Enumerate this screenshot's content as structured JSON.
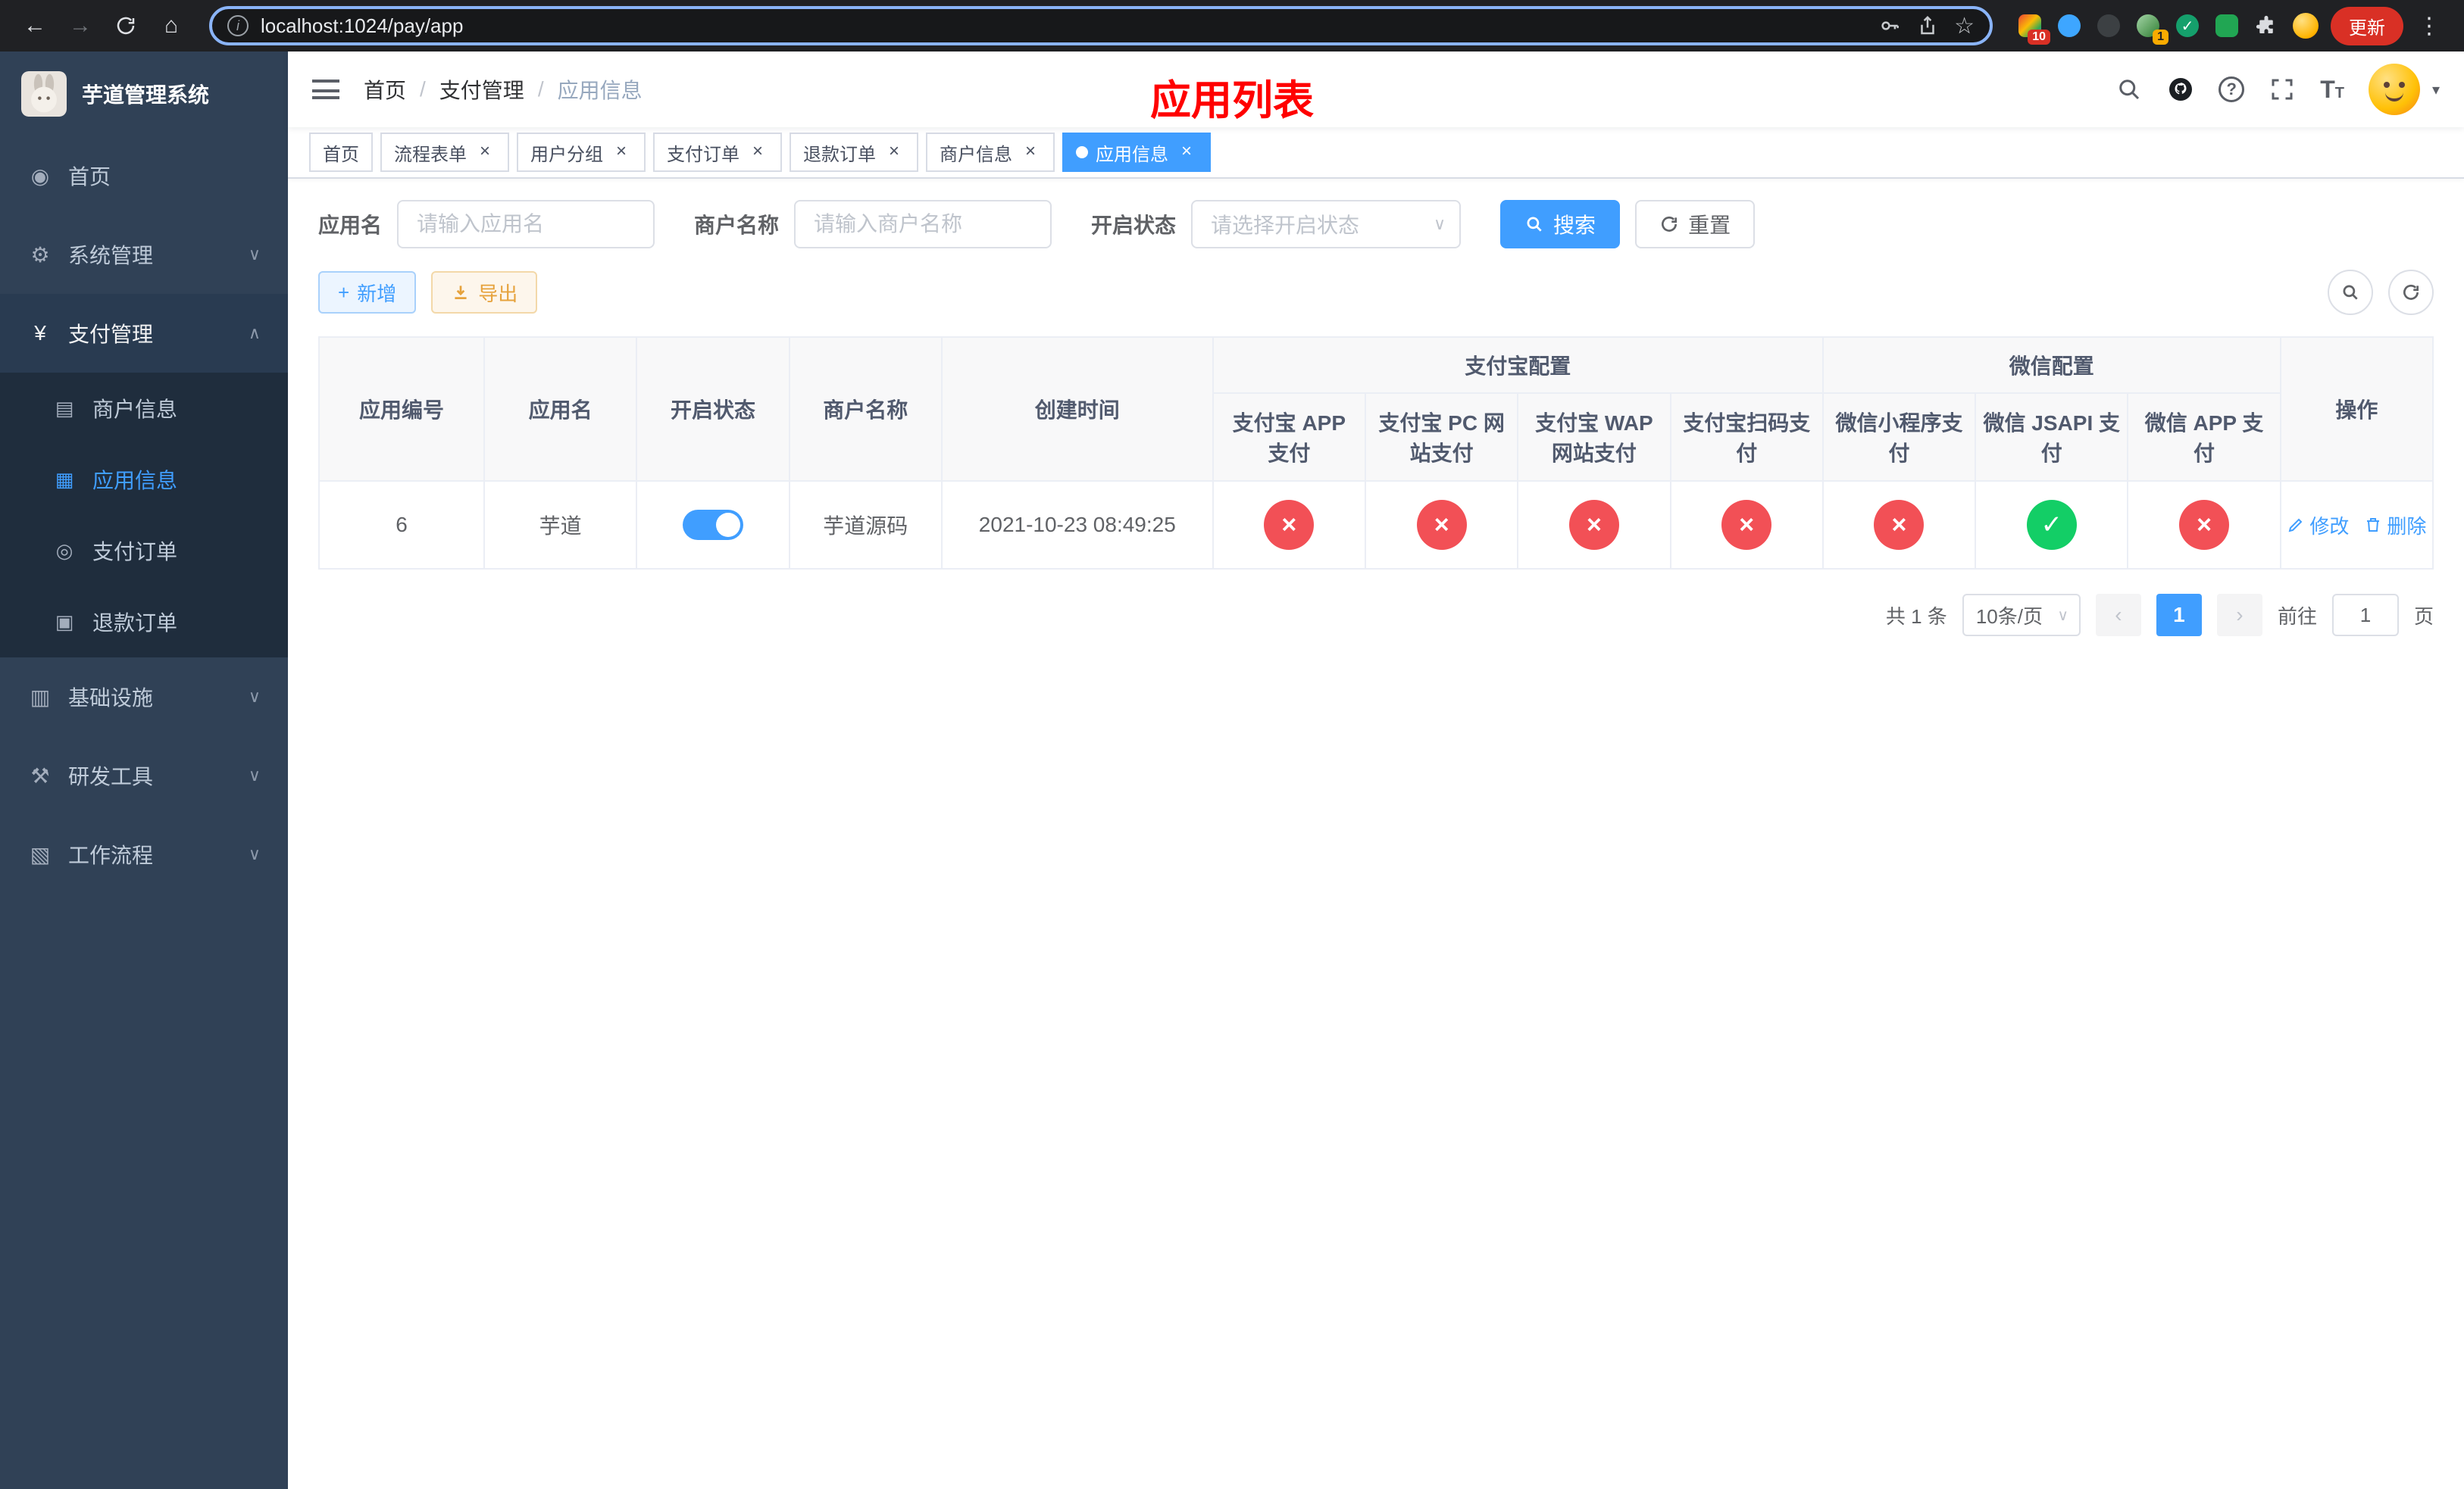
{
  "icons": {
    "back": "←",
    "forward": "→",
    "home": "⌂",
    "star": "☆",
    "more": "⋮",
    "info": "i",
    "close": "×",
    "separator": "/",
    "chevron_down": "∨",
    "chevron_up": "∧",
    "caret_down": "▾",
    "plus": "+",
    "check": "✓",
    "cross": "×",
    "prev": "‹",
    "next": "›",
    "question": "?",
    "menu_home": "◉",
    "menu_system": "⚙",
    "menu_pay": "¥",
    "menu_merchant": "▤",
    "menu_app": "▦",
    "menu_order": "◎",
    "menu_refund": "▣",
    "menu_infra": "▥",
    "menu_dev": "⚒",
    "menu_flow": "▧",
    "font_large": "T",
    "font_small": "T"
  },
  "browser": {
    "url": "localhost:1024/pay/app",
    "update_label": "更新",
    "ext_badge_1": "10",
    "ext_badge_2": "1"
  },
  "sidebar": {
    "title": "芋道管理系统",
    "menu": [
      {
        "label": "首页"
      },
      {
        "label": "系统管理"
      },
      {
        "label": "支付管理"
      },
      {
        "label": "商户信息"
      },
      {
        "label": "应用信息"
      },
      {
        "label": "支付订单"
      },
      {
        "label": "退款订单"
      },
      {
        "label": "基础设施"
      },
      {
        "label": "研发工具"
      },
      {
        "label": "工作流程"
      }
    ]
  },
  "header": {
    "breadcrumb": [
      "首页",
      "支付管理",
      "应用信息"
    ],
    "page_title": "应用列表"
  },
  "tabs": [
    {
      "label": "首页"
    },
    {
      "label": "流程表单"
    },
    {
      "label": "用户分组"
    },
    {
      "label": "支付订单"
    },
    {
      "label": "退款订单"
    },
    {
      "label": "商户信息"
    },
    {
      "label": "应用信息"
    }
  ],
  "filters": {
    "app_name_label": "应用名",
    "app_name_placeholder": "请输入应用名",
    "merchant_label": "商户名称",
    "merchant_placeholder": "请输入商户名称",
    "status_label": "开启状态",
    "status_placeholder": "请选择开启状态",
    "search_label": "搜索",
    "reset_label": "重置"
  },
  "toolbar": {
    "add_label": "新增",
    "export_label": "导出"
  },
  "table": {
    "col_app_id": "应用编号",
    "col_app_name": "应用名",
    "col_status": "开启状态",
    "col_merchant": "商户名称",
    "col_created": "创建时间",
    "group_alipay": "支付宝配置",
    "group_wechat": "微信配置",
    "alipay_cols": [
      "支付宝 APP 支付",
      "支付宝 PC 网站支付",
      "支付宝 WAP 网站支付",
      "支付宝扫码支付"
    ],
    "wechat_cols": [
      "微信小程序支付",
      "微信 JSAPI 支付",
      "微信 APP 支付"
    ],
    "col_actions": "操作",
    "rows": [
      {
        "id": "6",
        "name": "芋道",
        "enabled": true,
        "merchant": "芋道源码",
        "created": "2021-10-23 08:49:25",
        "alipay": [
          "cross",
          "cross",
          "cross",
          "cross"
        ],
        "wechat": [
          "cross",
          "check",
          "cross"
        ],
        "edit_label": "修改",
        "delete_label": "删除"
      }
    ]
  },
  "pagination": {
    "total": "共 1 条",
    "page_size": "10条/页",
    "page": "1",
    "goto_label": "前往",
    "goto_value": "1",
    "unit_label": "页"
  }
}
